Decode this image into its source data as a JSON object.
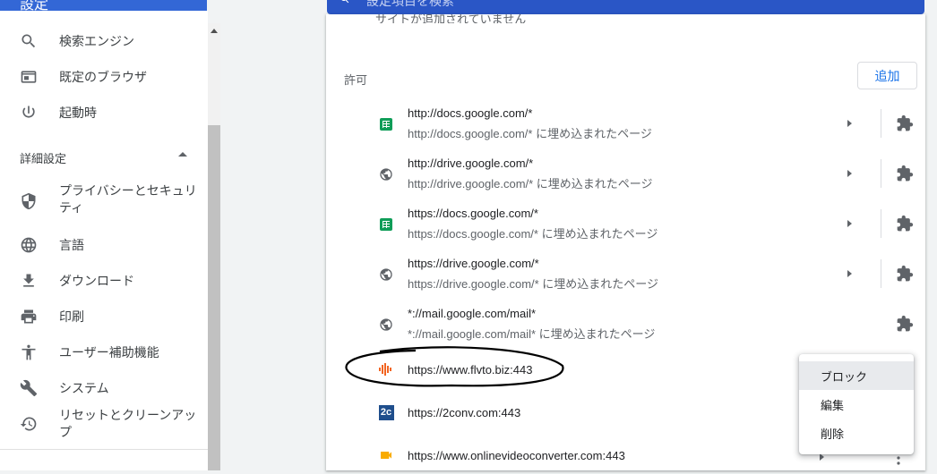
{
  "header": {
    "title": "設定",
    "search_placeholder": "設定項目を検索"
  },
  "sidebar": {
    "items": [
      {
        "label": "検索エンジン",
        "icon": "search-icon"
      },
      {
        "label": "既定のブラウザ",
        "icon": "browser-icon"
      },
      {
        "label": "起動時",
        "icon": "power-icon"
      }
    ],
    "advanced_label": "詳細設定",
    "advanced_items": [
      {
        "label": "プライバシーとセキュリティ",
        "icon": "shield-icon"
      },
      {
        "label": "言語",
        "icon": "globe-icon"
      },
      {
        "label": "ダウンロード",
        "icon": "download-icon"
      },
      {
        "label": "印刷",
        "icon": "printer-icon"
      },
      {
        "label": "ユーザー補助機能",
        "icon": "accessibility-icon"
      },
      {
        "label": "システム",
        "icon": "wrench-icon"
      },
      {
        "label": "リセットとクリーンアップ",
        "icon": "restore-icon"
      }
    ]
  },
  "main": {
    "prev_text": "サイトが追加されていません",
    "allow_label": "許可",
    "add_button": "追加",
    "sites": [
      {
        "title": "http://docs.google.com/*",
        "sub": "http://docs.google.com/* に埋め込まれたページ",
        "icon": "sheets-icon"
      },
      {
        "title": "http://drive.google.com/*",
        "sub": "http://drive.google.com/* に埋め込まれたページ",
        "icon": "globe-icon"
      },
      {
        "title": "https://docs.google.com/*",
        "sub": "https://docs.google.com/* に埋め込まれたページ",
        "icon": "sheets-icon"
      },
      {
        "title": "https://drive.google.com/*",
        "sub": "https://drive.google.com/* に埋め込まれたページ",
        "icon": "globe-icon"
      },
      {
        "title": "*://mail.google.com/mail*",
        "sub": "*://mail.google.com/mail* に埋め込まれたページ",
        "icon": "globe-icon"
      },
      {
        "title": "https://www.flvto.biz:443",
        "icon": "flvto-icon"
      },
      {
        "title": "https://2conv.com:443",
        "icon": "2conv-icon"
      },
      {
        "title": "https://www.onlinevideoconverter.com:443",
        "icon": "camera-icon"
      }
    ]
  },
  "menu": {
    "items": [
      "ブロック",
      "編集",
      "削除"
    ],
    "highlighted": "ブロック"
  },
  "colors": {
    "accent": "#1a73e8",
    "header_blue": "#3367d6",
    "annotation": "#000000"
  }
}
